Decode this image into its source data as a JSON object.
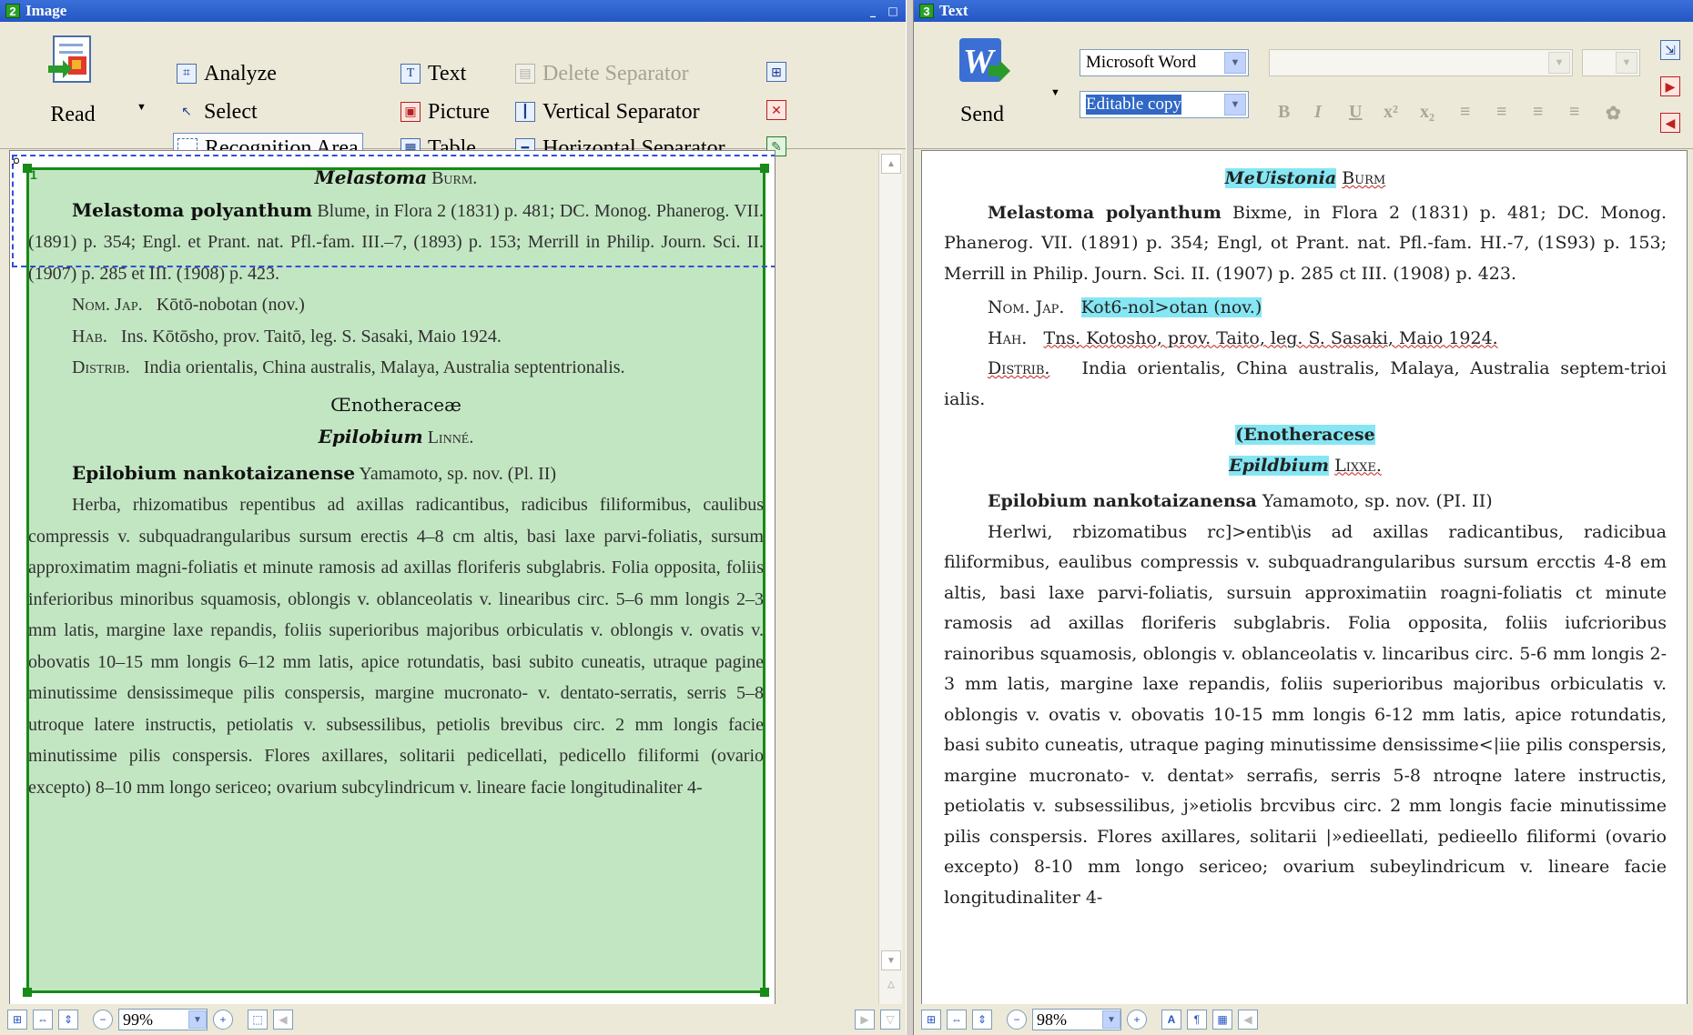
{
  "image_pane": {
    "number": "2",
    "title": "Image",
    "minimize": "_",
    "maximize": "□",
    "toolbar": {
      "read_label": "Read",
      "analyze": "Analyze",
      "select": "Select",
      "recognition_area": "Recognition Area",
      "text": "Text",
      "picture": "Picture",
      "table": "Table",
      "delete_separator": "Delete Separator",
      "vertical_separator": "Vertical Separator",
      "horizontal_separator": "Horizontal Separator"
    },
    "zoom": "99%",
    "area_index": "1",
    "scan": {
      "genus1": "Melastoma",
      "genus1_author": "Burm.",
      "sp1_name": "Melastoma polyanthum",
      "sp1_ref": "Blume, in Flora 2 (1831) p. 481; DC. Monog. Phanerog. VII. (1891) p. 354; Engl. et Prant. nat. Pfl.-fam. III.–7, (1893) p. 153; Merrill in Philip. Journ. Sci. II. (1907) p. 285 et III. (1908) p. 423.",
      "sp1_nom": "Nom. Jap.",
      "sp1_nom_val": "Kōtō-nobotan (nov.)",
      "sp1_hab": "Hab.",
      "sp1_hab_val": "Ins. Kōtōsho, prov. Taitō, leg. S. Sasaki, Maio 1924.",
      "sp1_distrib": "Distrib.",
      "sp1_distrib_val": "India orientalis, China australis, Malaya, Australia septentrionalis.",
      "family": "Œnotheraceæ",
      "genus2": "Epilobium",
      "genus2_author": "Linné.",
      "sp2_name": "Epilobium nankotaizanense",
      "sp2_author": "Yamamoto, sp. nov. (Pl. II)",
      "sp2_body": "Herba, rhizomatibus repentibus ad axillas radicantibus, radicibus filiformibus, caulibus compressis v. subquadrangularibus sursum erectis 4–8 cm altis, basi laxe parvi-foliatis, sursum approximatim magni-foliatis et minute ramosis ad axillas floriferis subglabris. Folia opposita, foliis inferioribus minoribus squamosis, oblongis v. oblanceolatis v. linearibus circ. 5–6 mm longis 2–3 mm latis, margine laxe repandis, foliis superioribus majoribus orbiculatis v. oblongis v. ovatis v. obovatis 10–15 mm longis 6–12 mm latis, apice rotundatis, basi subito cuneatis, utraque pagine minutissime densissimeque pilis conspersis, margine mucronato- v. dentato-serratis, serris 5–8 utroque latere instructis, petiolatis v. subsessilibus, petiolis brevibus circ. 2 mm longis facie minutissime pilis conspersis. Flores axillares, solitarii pedicellati, pedicello filiformi (ovario excepto) 8–10 mm longo sericeo; ovarium subcylindricum v. lineare facie longitudinaliter 4-"
    }
  },
  "text_pane": {
    "number": "3",
    "title": "Text",
    "toolbar": {
      "send_label": "Send",
      "format_combo": "Microsoft Word",
      "copy_combo": "Editable copy"
    },
    "zoom": "98%",
    "ocr": {
      "genus1": "MeUistonia",
      "genus1_author": "Burm",
      "sp1_name": "Melastoma polyanthum",
      "sp1_ref": "Bixme, in Flora 2 (1831) p. 481; DC. Monog. Phanerog. VII. (1891) p. 354; Engl, ot Prant. nat. Pfl.-fam. HI.-7, (1S93) p. 153; Merrill in Philip. Journ. Sci. II. (1907) p. 285 ct III. (1908) p. 423.",
      "sp1_nom": "Nom. Jap.",
      "sp1_nom_val": "Kot6-nol>otan (nov.)",
      "sp1_hab": "Hah.",
      "sp1_hab_val": "Tns. Kotosho, prov. Taito, leg. S. Sasaki, Maio 1924.",
      "sp1_distrib": "Distrib.",
      "sp1_distrib_val": "India orientalis, China australis, Malaya, Australia septem-trioi ialis.",
      "family": "(Enotheracese",
      "genus2": "Epildbium",
      "genus2_author": "Lixxe.",
      "sp2_name": "Epilobium nankotaizanensa",
      "sp2_author": "Yamamoto, sp. nov. (PI. II)",
      "sp2_body": "Herlwi, rbizomatibus rc]>entib\\is ad axillas radicantibus, radicibua filiformibus, eaulibus compressis v. subquadrangularibus sursum ercctis 4-8 em altis, basi laxe parvi-foliatis, sursuin approximatiin roagni-foliatis ct minute ramosis ad axillas floriferis subglabris. Folia opposita, foliis iufcrioribus rainoribus squamosis, oblongis v. oblanceolatis v. lincaribus circ. 5-6 mm longis 2-3 mm latis, margine laxe repandis, foliis superioribus majoribus orbiculatis v. oblongis v. ovatis v. obovatis 10-15 mm longis 6-12 mm latis, apice rotundatis, basi subito cuneatis, utraque paging minutissime densissime<|iie pilis conspersis, margine mucronato- v. dentat» serrafis, serris 5-8 ntroqne latere instructis, petiolatis v. subsessilibus, j»etiolis brcvibus circ. 2 mm longis facie minutissime pilis conspersis. Flores axillares, solitarii |»edieellati, pedieello filiformi (ovario excepto) 8-10 mm longo sericeo; ovarium subeylindricum v. lineare facie longitudinaliter 4-"
    }
  }
}
